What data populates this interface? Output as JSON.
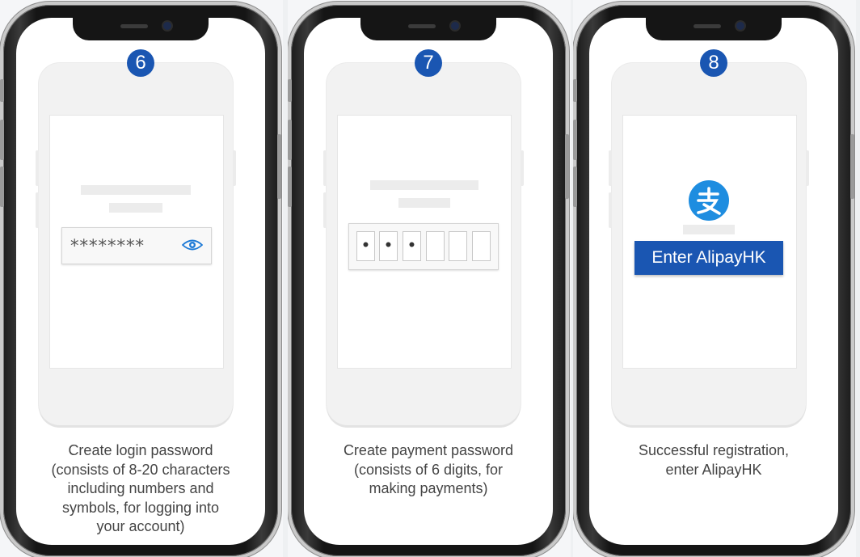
{
  "colors": {
    "accent_blue": "#1a56b2",
    "alipay_logo_blue": "#1e8de0",
    "phone_frame": "#151515",
    "caption_text": "#444444"
  },
  "steps": [
    {
      "number": "6",
      "password_mask": "********",
      "caption_lines": [
        "Create login password",
        "(consists of 8-20 characters",
        "including numbers and",
        "symbols, for logging into",
        "your account)"
      ]
    },
    {
      "number": "7",
      "pin_digits": [
        "•",
        "•",
        "•",
        "",
        "",
        ""
      ],
      "caption_lines": [
        "Create payment password",
        "(consists of 6 digits, for",
        "making payments)"
      ]
    },
    {
      "number": "8",
      "button_label": "Enter AlipayHK",
      "logo_icon": "alipay-logo-icon",
      "caption_lines": [
        "Successful registration,",
        "enter AlipayHK"
      ]
    }
  ]
}
